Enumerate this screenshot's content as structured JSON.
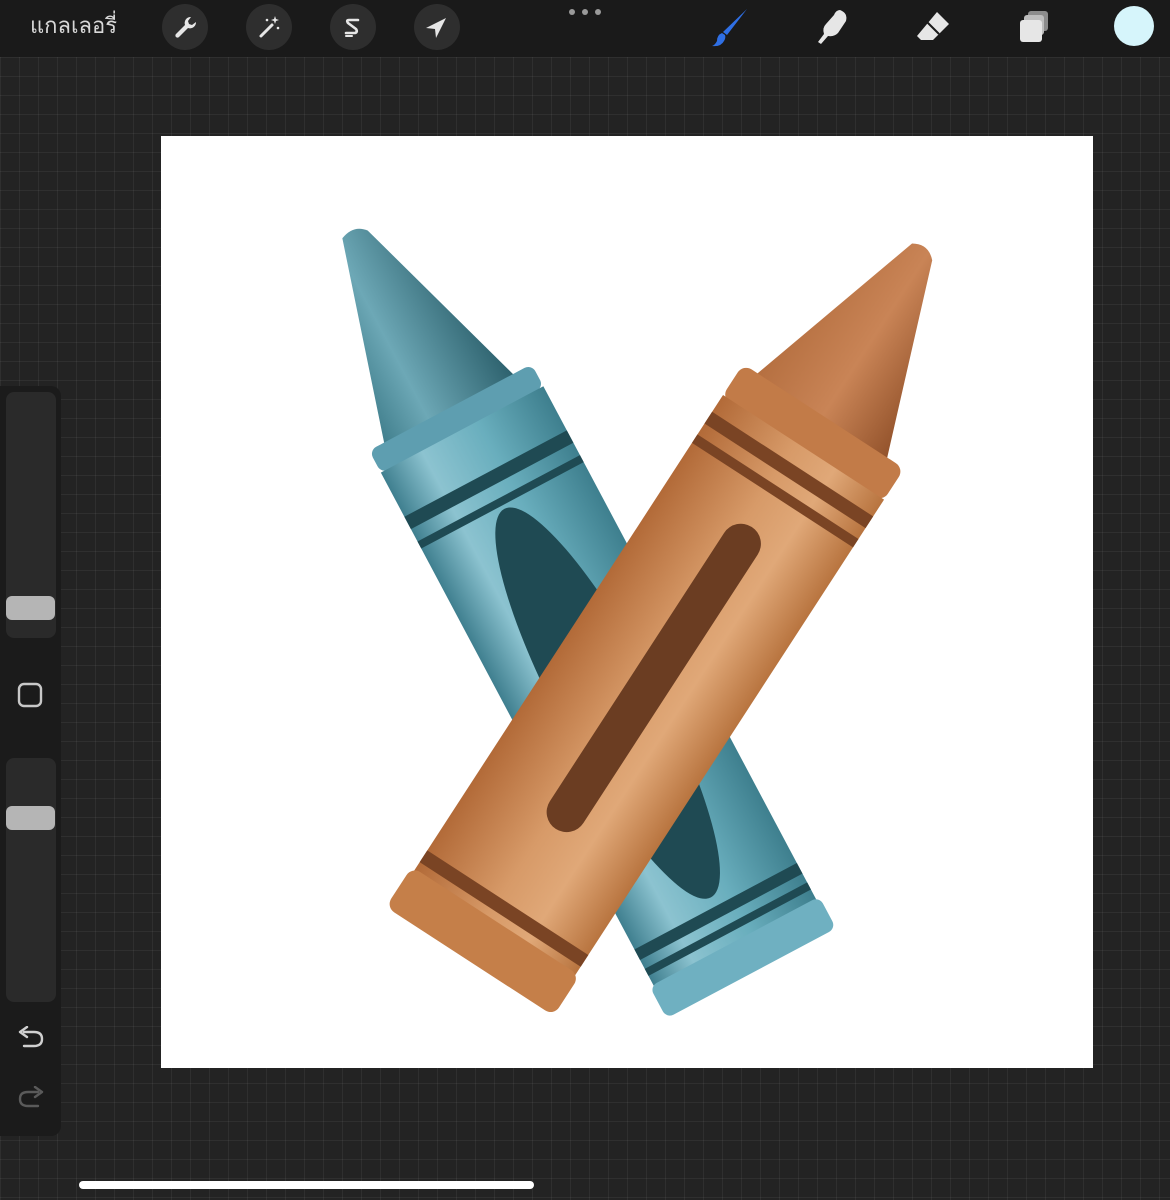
{
  "toolbar": {
    "gallery_label": "แกลเลอรี่",
    "left_tools": [
      {
        "name": "actions",
        "icon": "wrench-icon"
      },
      {
        "name": "adjustments",
        "icon": "magic-wand-icon"
      },
      {
        "name": "selection",
        "icon": "selection-s-icon"
      },
      {
        "name": "transform",
        "icon": "arrow-cursor-icon"
      }
    ],
    "more_icon": "more-dots-icon",
    "right_tools": [
      {
        "name": "brush",
        "icon": "brush-icon",
        "active": true,
        "color": "#2f6fe4"
      },
      {
        "name": "smudge",
        "icon": "smudge-finger-icon",
        "active": false,
        "color": "#e6e6e6"
      },
      {
        "name": "eraser",
        "icon": "eraser-icon",
        "active": false,
        "color": "#e6e6e6"
      },
      {
        "name": "layers",
        "icon": "layers-icon",
        "active": false,
        "color": "#e6e6e6"
      }
    ],
    "current_color": "#d6f5fb"
  },
  "sidebar": {
    "brush_size_level": 0.08,
    "opacity_level": 0.78,
    "modifier_icon": "square-modifier-icon",
    "undo_icon": "undo-icon",
    "redo_icon": "redo-icon"
  },
  "canvas": {
    "background": "#ffffff",
    "artwork": "two-crossed-crayons",
    "crayon_colors": {
      "blue": "#5fa3b3",
      "blue_dark": "#1f4a53",
      "brown": "#c9854f",
      "brown_dark": "#6b3d22"
    }
  }
}
